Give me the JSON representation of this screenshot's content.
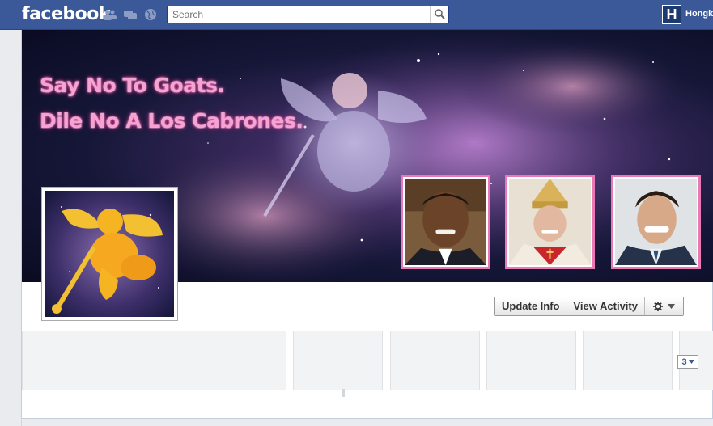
{
  "topbar": {
    "logo": "facebook",
    "search_placeholder": "Search",
    "user_initial": "H",
    "user_name": "Hongk"
  },
  "cover": {
    "line1": "Say No To Goats.",
    "line2": "Dile No A Los Cabrones."
  },
  "actions": {
    "update_info": "Update Info",
    "view_activity": "View Activity"
  },
  "more": {
    "count": "3"
  },
  "colors": {
    "brand": "#3b5998",
    "cover_text": "#f5a3d2",
    "frame": "#e978b4"
  }
}
